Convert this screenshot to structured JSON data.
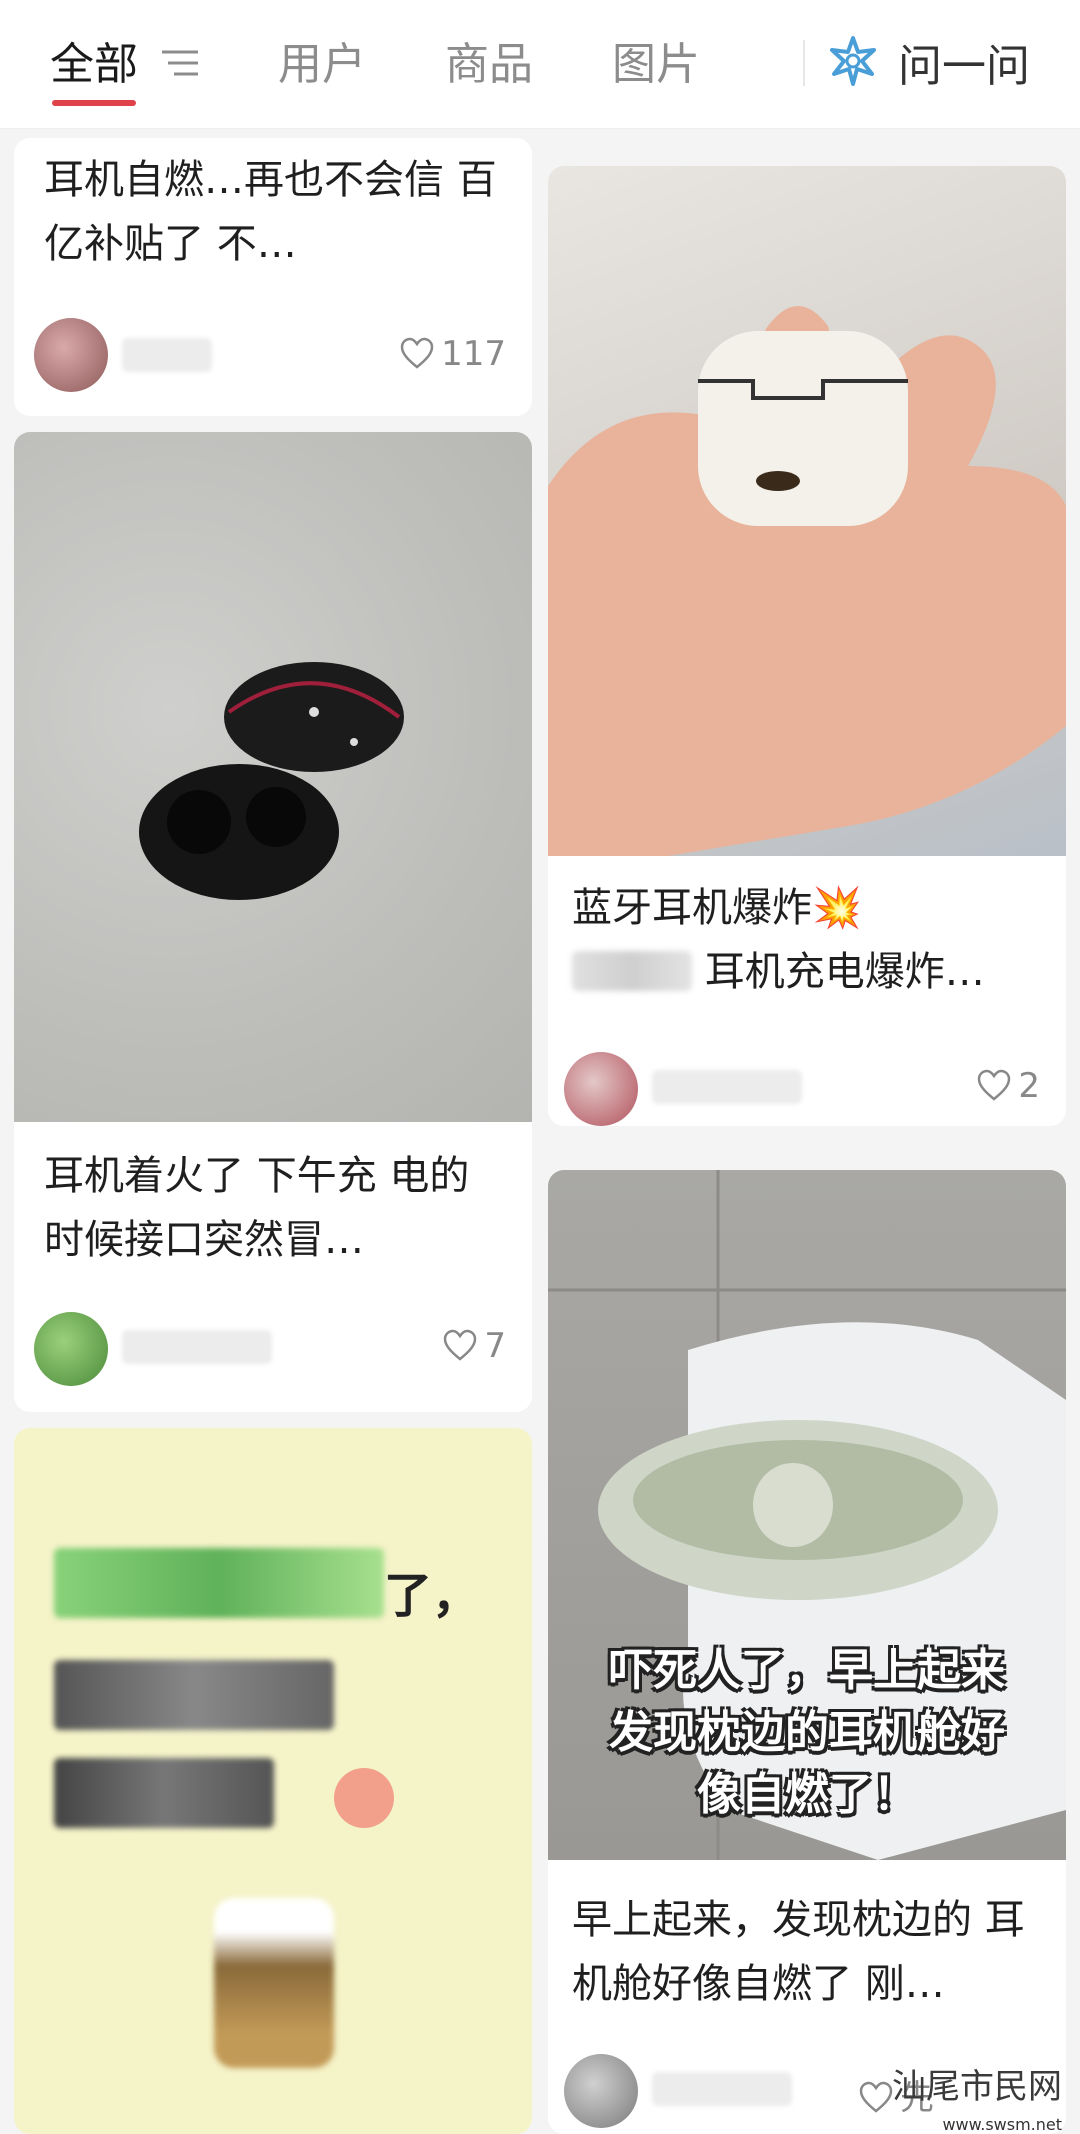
{
  "tabs": {
    "all": "全部",
    "users": "用户",
    "goods": "商品",
    "images": "图片",
    "ask": "问一问"
  },
  "colors": {
    "accent": "#e0424a",
    "ask_icon": "#4a9ed8"
  },
  "cards": [
    {
      "title": "耳机自燃…再也不会信 百亿补贴了 不…",
      "likes": "117"
    },
    {
      "title": "耳机着火了 下午充 电的时候接口突然冒…",
      "likes": "7"
    },
    {
      "title": "蓝牙耳机爆炸",
      "subtitle_tail": "耳机充电爆炸…",
      "likes": "2"
    },
    {
      "title": "早上起来，发现枕边的 耳机舱好像自燃了 刚…",
      "overlay": "吓死人了，早上起来发现枕边的耳机舱好像自燃了！",
      "likes": "先"
    }
  ],
  "blurred_image_text": [
    "了，"
  ],
  "watermark": {
    "text": "汕尾市民网",
    "url": "www.swsm.net"
  },
  "icons": [
    "filter-icon",
    "sparkle-icon",
    "heart-icon",
    "explosion-emoji"
  ]
}
